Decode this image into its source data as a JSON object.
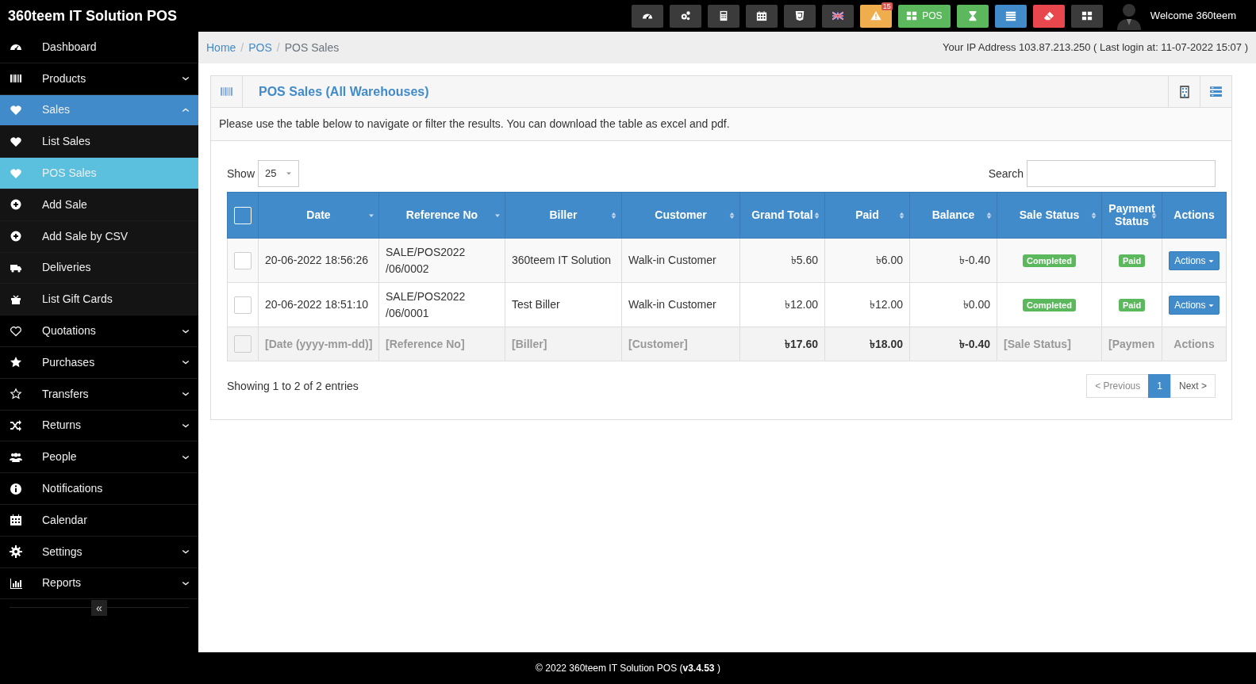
{
  "app": {
    "title": "360teem IT Solution POS",
    "welcome": "Welcome 360teem"
  },
  "toolbar": [
    {
      "color": "#3b3b3b"
    },
    {
      "color": "#3b3b3b"
    },
    {
      "color": "#3b3b3b"
    },
    {
      "color": "#3b3b3b"
    },
    {
      "color": "#3b3b3b"
    },
    {
      "color": "#3b3b3b"
    },
    {
      "color": "#f0ad4e",
      "badge": "15"
    },
    {
      "color": "#5cb85c",
      "label": "POS"
    },
    {
      "color": "#5cb85c"
    },
    {
      "color": "#428bca"
    },
    {
      "color": "#e9474e"
    },
    {
      "color": "#3b3b3b"
    }
  ],
  "sidebar": {
    "items": [
      {
        "label": "Dashboard",
        "selected": false
      },
      {
        "label": "Products",
        "selected": false,
        "expanded": false
      },
      {
        "label": "Sales",
        "selected": true,
        "expanded": true,
        "children": [
          {
            "label": "List Sales",
            "selected": false
          },
          {
            "label": "POS Sales",
            "selected": true
          },
          {
            "label": "Add Sale",
            "selected": false
          },
          {
            "label": "Add Sale by CSV",
            "selected": false
          },
          {
            "label": "Deliveries",
            "selected": false
          },
          {
            "label": "List Gift Cards",
            "selected": false
          }
        ]
      },
      {
        "label": "Quotations",
        "selected": false,
        "expanded": false
      },
      {
        "label": "Purchases",
        "selected": false,
        "expanded": false
      },
      {
        "label": "Transfers",
        "selected": false,
        "expanded": false
      },
      {
        "label": "Returns",
        "selected": false,
        "expanded": false
      },
      {
        "label": "People",
        "selected": false,
        "expanded": false
      },
      {
        "label": "Notifications",
        "selected": false
      },
      {
        "label": "Calendar",
        "selected": false
      },
      {
        "label": "Settings",
        "selected": false,
        "expanded": false
      },
      {
        "label": "Reports",
        "selected": false,
        "expanded": false
      }
    ],
    "collapse": "«"
  },
  "breadcrumb": [
    {
      "label": "Home",
      "kind": "link"
    },
    {
      "separator": "/",
      "label": "POS",
      "kind": "link"
    },
    {
      "separator": "/",
      "label": "POS Sales",
      "kind": "current"
    }
  ],
  "login_info": "Your IP Address 103.87.213.250 ( Last login at: 11-07-2022 15:07 )",
  "panel": {
    "title": "POS Sales (All Warehouses)",
    "description": "Please use the table below to navigate or filter the results. You can download the table as excel and pdf."
  },
  "table": {
    "show_label": "Show",
    "page_size": "25",
    "search_label": "Search",
    "columns": [
      {
        "label": "Date",
        "sortable": true,
        "sorted_descending": true
      },
      {
        "label": "Reference No",
        "sortable": true,
        "sorted_descending": true
      },
      {
        "label": "Biller",
        "sortable": true,
        "sorted_descending": false
      },
      {
        "label": "Customer",
        "sortable": true,
        "sorted_descending": false
      },
      {
        "label": "Grand Total",
        "sortable": true,
        "sorted_descending": false
      },
      {
        "label": "Paid",
        "sortable": true,
        "sorted_descending": false
      },
      {
        "label": "Balance",
        "sortable": true,
        "sorted_descending": false
      },
      {
        "label": "Sale Status",
        "sortable": true,
        "sorted_descending": false
      },
      {
        "label": "Payment Status",
        "sortable": true,
        "sorted_descending": false
      },
      {
        "label": "Actions",
        "sortable": false
      }
    ],
    "all_checked": false,
    "rows": [
      {
        "checked": false,
        "date": "20-06-2022 18:56:26",
        "reference": "SALE/POS2022 /06/0002",
        "biller": "360teem IT Solution",
        "customer": "Walk-in Customer",
        "grand_total": "৳5.60",
        "paid": "৳6.00",
        "balance": "৳-0.40",
        "sale_status": "Completed",
        "payment_status": "Paid",
        "action": "Actions"
      },
      {
        "checked": false,
        "date": "20-06-2022 18:51:10",
        "reference": "SALE/POS2022 /06/0001",
        "biller": "Test Biller",
        "customer": "Walk-in Customer",
        "grand_total": "৳12.00",
        "paid": "৳12.00",
        "balance": "৳0.00",
        "sale_status": "Completed",
        "payment_status": "Paid",
        "action": "Actions"
      }
    ],
    "footer": {
      "checked": false,
      "date": "[Date (yyyy-mm-dd)]",
      "reference": "[Reference No]",
      "biller": "[Biller]",
      "customer": "[Customer]",
      "grand_total": "৳17.60",
      "paid": "৳18.00",
      "balance": "৳-0.40",
      "sale_status": "[Sale Status]",
      "payment_status": "[Paymen",
      "action": "Actions"
    },
    "info": "Showing 1 to 2 of 2 entries",
    "pagination": [
      {
        "label": "< Previous",
        "kind": "prev",
        "selected": false
      },
      {
        "label": "1",
        "kind": "page",
        "selected": true
      },
      {
        "label": "Next >",
        "kind": "next",
        "selected": false
      }
    ]
  },
  "footer": "© 2022 360teem IT Solution POS (**v3.4.53** )"
}
